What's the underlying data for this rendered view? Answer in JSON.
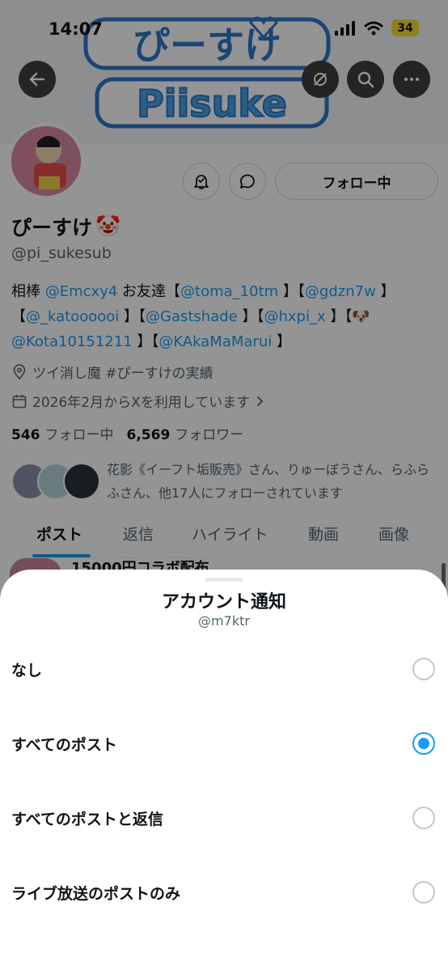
{
  "status_bar": {
    "time": "14:07",
    "battery": "34"
  },
  "banner": {
    "logo_top": "ぴーすけ",
    "logo_bottom": "Piisuke"
  },
  "profile": {
    "display_name": "ぴーすけ",
    "name_emoji": "🤡",
    "handle": "@pi_sukesub",
    "follow_button": "フォロー中",
    "bio": [
      {
        "t": "相棒 ",
        "m": false
      },
      {
        "t": "@Emcxy4",
        "m": true
      },
      {
        "t": " お友達【",
        "m": false
      },
      {
        "t": "@toma_10tm",
        "m": true
      },
      {
        "t": " 】【",
        "m": false
      },
      {
        "t": "@gdzn7w",
        "m": true
      },
      {
        "t": " 】【",
        "m": false
      },
      {
        "t": "@_katoooooi",
        "m": true
      },
      {
        "t": " 】【",
        "m": false
      },
      {
        "t": "@Gastshade",
        "m": true
      },
      {
        "t": " 】【",
        "m": false
      },
      {
        "t": "@hxpi_x",
        "m": true
      },
      {
        "t": " 】【🐶",
        "m": false
      },
      {
        "t": "@Kota10151211",
        "m": true
      },
      {
        "t": " 】【",
        "m": false
      },
      {
        "t": "@KAkaMaMarui",
        "m": true
      },
      {
        "t": " 】",
        "m": false
      }
    ],
    "location": "ツイ消し魔 #ぴーすけの実績",
    "joined": "2026年2月からXを利用しています",
    "following_count": "546",
    "following_label": "フォロー中",
    "followers_count": "6,569",
    "followers_label": "フォロワー",
    "known_followers": "花影《イーフト垢販売》さん、りゅーぼうさん、らふらふさん、他17人にフォローされています"
  },
  "tabs": [
    "ポスト",
    "返信",
    "ハイライト",
    "動画",
    "画像"
  ],
  "peek_post": "15000円コラボ配布",
  "sheet": {
    "title": "アカウント通知",
    "subtitle": "@m7ktr",
    "options": [
      {
        "label": "なし",
        "checked": false
      },
      {
        "label": "すべてのポスト",
        "checked": true
      },
      {
        "label": "すべてのポストと返信",
        "checked": false
      },
      {
        "label": "ライブ放送のポストのみ",
        "checked": false
      }
    ]
  },
  "colors": {
    "accent": "#1d9bf0",
    "overlay": "rgba(0,0,0,0.42)"
  }
}
